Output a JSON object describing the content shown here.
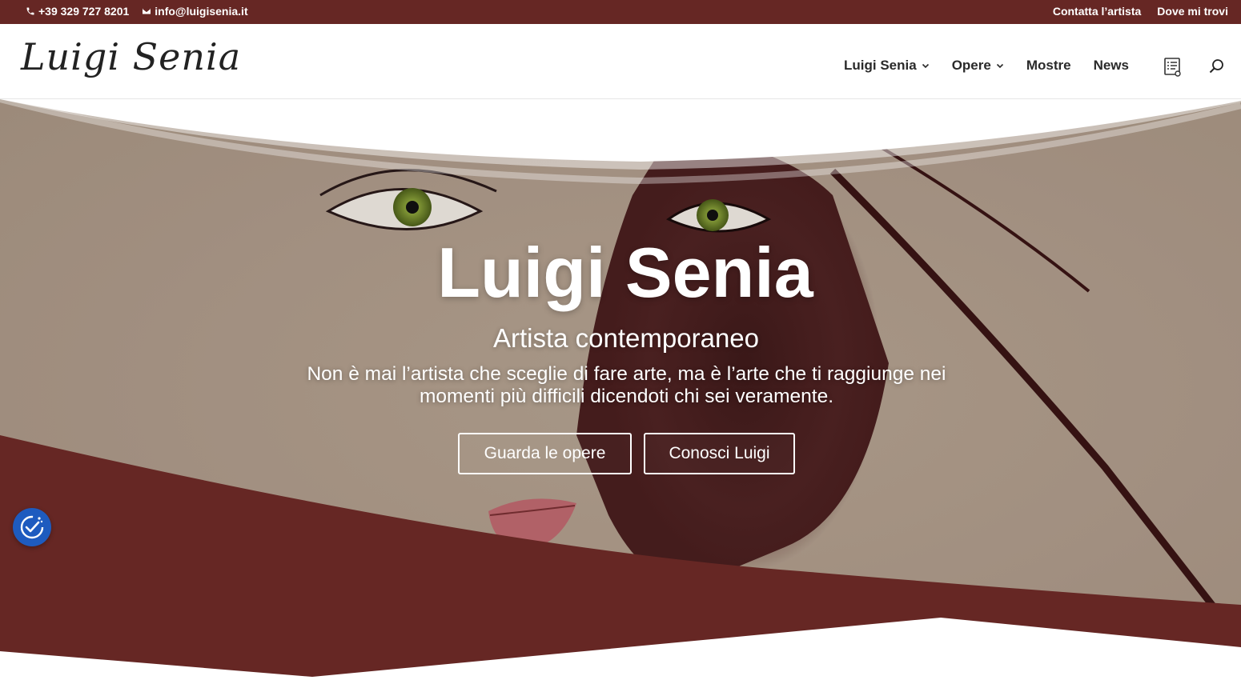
{
  "topbar": {
    "phone": "+39 329 727 8201",
    "email": "info@luigisenia.it",
    "links": [
      "Contatta l’artista",
      "Dove mi trovi"
    ]
  },
  "header": {
    "logo_text": "Luigi Senia",
    "nav": [
      {
        "label": "Luigi Senia",
        "has_dropdown": true
      },
      {
        "label": "Opere",
        "has_dropdown": true
      },
      {
        "label": "Mostre",
        "has_dropdown": false
      },
      {
        "label": "News",
        "has_dropdown": false
      }
    ],
    "icons": [
      "list-icon",
      "search-icon"
    ]
  },
  "hero": {
    "title": "Luigi Senia",
    "subtitle": "Artista contemporaneo",
    "quote": "Non è mai l’artista che sceglie di fare arte, ma è l’arte che ti raggiunge nei momenti più difficili dicendoti chi sei veramente.",
    "buttons": [
      "Guarda le opere",
      "Conosci Luigi"
    ]
  },
  "colors": {
    "brand": "#662724",
    "accessibility_widget": "#1e5bbf"
  },
  "accessibility": {
    "icon": "accessibility-icon"
  }
}
